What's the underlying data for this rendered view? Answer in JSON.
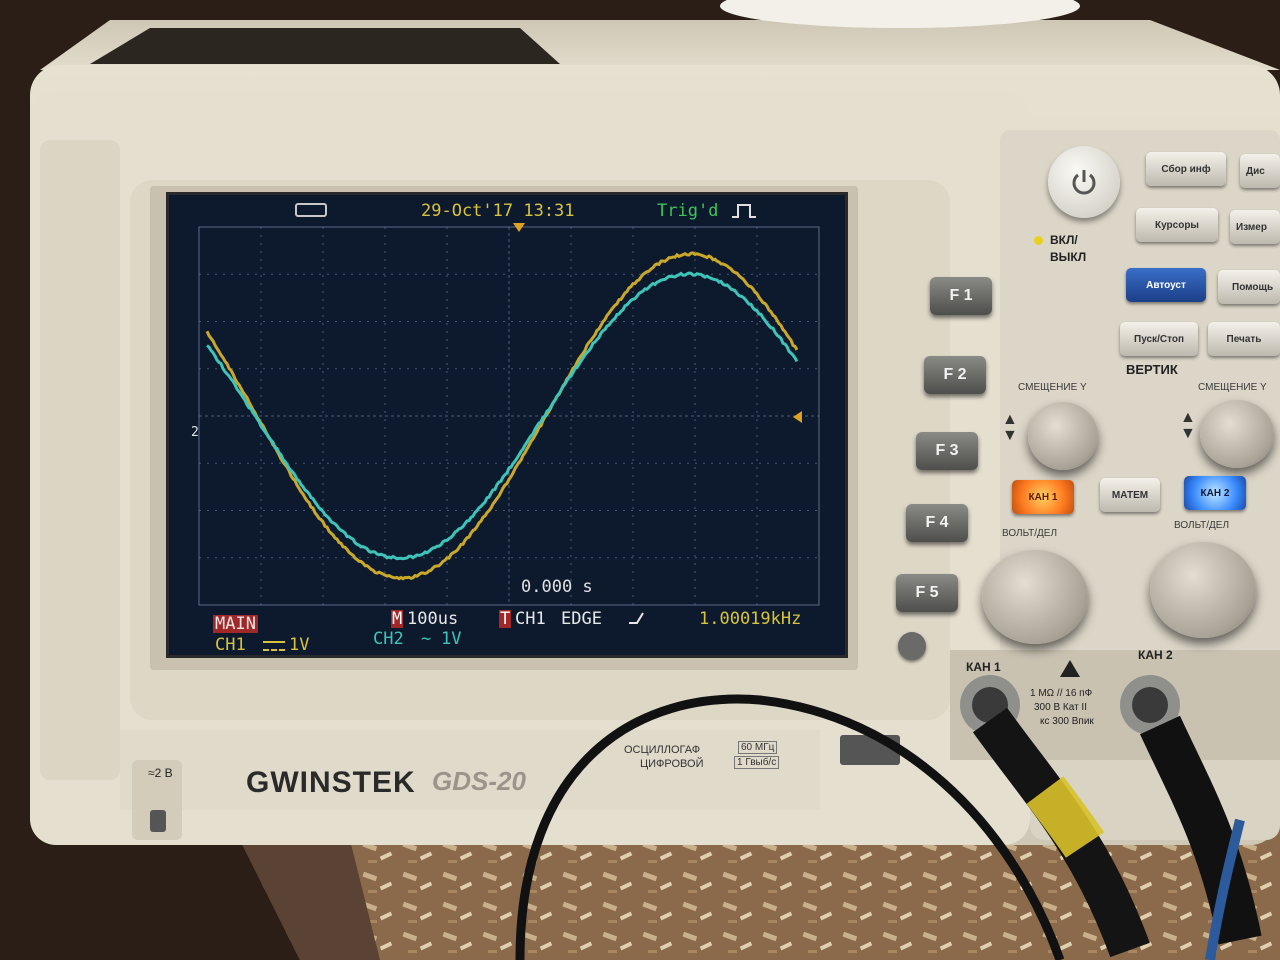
{
  "scope": {
    "brand": "GWINSTEK",
    "model": "GDS-20",
    "descriptor_line1": "ОСЦИЛЛОГАФ",
    "descriptor_line2": "ЦИФРОВОЙ",
    "spec_line1": "60 МГц",
    "spec_line2": "1 Гвыб/с",
    "probe_comp": "≈2 В"
  },
  "screen": {
    "datetime": "29-Oct'17 13:31",
    "trig_status": "Trig'd",
    "time_offset": "0.000 s",
    "mode": "MAIN",
    "timebase_marker": "M",
    "timebase": "100us",
    "trig_marker": "T",
    "trig_source": "CH1",
    "trig_type": "EDGE",
    "frequency": "1.00019kHz",
    "ch1_label": "CH1",
    "ch1_scale": "1V",
    "ch2_label": "CH2",
    "ch2_scale": "1V",
    "ch_marker": "2",
    "ch1_color": "#c9a82a",
    "ch2_color": "#3ec4b8"
  },
  "softkeys": [
    "F 1",
    "F 2",
    "F 3",
    "F 4",
    "F 5"
  ],
  "panel": {
    "power_label_1": "ВКЛ/",
    "power_label_2": "ВЫКЛ",
    "buttons": {
      "acquire": "Сбор инф",
      "display": "Дис",
      "cursors": "Курсоры",
      "measure": "Измер",
      "autoset": "Автоуст",
      "help": "Помощь",
      "run_stop": "Пуск/Стоп",
      "print": "Печать",
      "ch1": "КАН 1",
      "math": "МАТЕМ",
      "ch2": "КАН 2"
    },
    "vertical_title": "ВЕРТИК",
    "offset_label_1": "СМЕЩЕНИЕ Y",
    "offset_label_2": "СМЕЩЕНИЕ Y",
    "volts_label_1": "ВОЛЬТ/ДЕЛ",
    "volts_label_2": "ВОЛЬТ/ДЕЛ",
    "input1_label": "КАН 1",
    "input2_label": "КАН 2",
    "input_spec_1": "1 MΩ // 16 пФ",
    "input_spec_2": "300 В Кат II",
    "input_spec_3": "кс 300 Впик"
  }
}
